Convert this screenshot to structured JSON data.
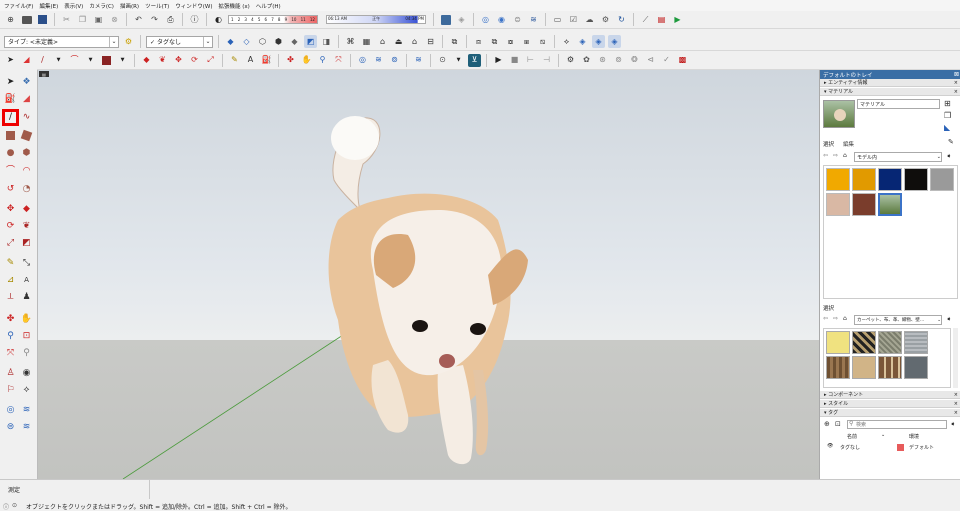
{
  "menu": [
    "ファイル(F)",
    "編集(E)",
    "表示(V)",
    "カメラ(C)",
    "描画(R)",
    "ツール(T)",
    "ウィンドウ(W)",
    "拡張機能 (x)",
    "ヘルプ(H)"
  ],
  "shadow": {
    "months": [
      "1",
      "2",
      "3",
      "4",
      "5",
      "6",
      "7",
      "8",
      "9",
      "10",
      "11",
      "12"
    ],
    "time_start": "06:13 AM",
    "noon": "正午",
    "time_end": "04:34 PM"
  },
  "toolbar2": {
    "type_value": "タイプ: <未定義>",
    "tag_value": "タグなし"
  },
  "viewport": {
    "label": ""
  },
  "tray": {
    "title": "デフォルトのトレイ",
    "entity_info": "エンティティ情報",
    "materials": "マテリアル",
    "material_name": "マテリアル",
    "select_tab": "選択",
    "edit_tab": "編集",
    "in_model": "モデル内",
    "select_label2": "選択",
    "library": "カーペット、布、革、織物、壁...",
    "swatch_colors": [
      "#f1a900",
      "#e19a00",
      "#062674",
      "#0f0d0c",
      "#9a9a9a",
      "#d9b8a4",
      "#7a3d2c"
    ],
    "components": "コンポーネント",
    "styles": "スタイル",
    "tags": "タグ",
    "search_placeholder": "検索",
    "col_name": "名前",
    "col_color": "環境",
    "tag_row_name": "タグなし",
    "tag_row_color_label": "デフォルト",
    "tag_row_color": "#e75b5b"
  },
  "status": {
    "measure_label": "測定",
    "hint": "オブジェクトをクリックまたはドラッグ。Shift = 追加/除外。Ctrl = 追加。Shift + Ctrl = 除外。"
  }
}
